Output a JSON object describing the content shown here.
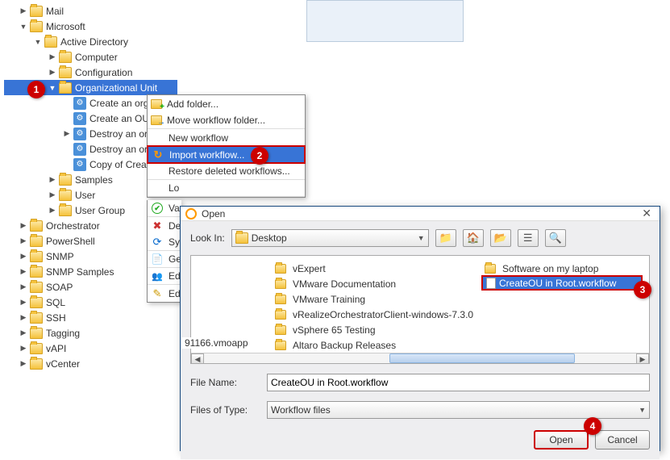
{
  "tree": {
    "mail": "Mail",
    "microsoft": "Microsoft",
    "ad": "Active Directory",
    "computer": "Computer",
    "configuration": "Configuration",
    "ou": "Organizational Unit",
    "create_org": "Create an org",
    "create_ou": "Create an OU",
    "destroy_or": "Destroy an or",
    "destroy_or2": "Destroy an or",
    "copy_of_crea": "Copy of Crea",
    "samples": "Samples",
    "user": "User",
    "user_group": "User Group",
    "orchestrator": "Orchestrator",
    "powershell": "PowerShell",
    "snmp": "SNMP",
    "snmp_samples": "SNMP Samples",
    "soap": "SOAP",
    "sql": "SQL",
    "ssh": "SSH",
    "tagging": "Tagging",
    "vapi": "vAPI",
    "vcenter": "vCenter"
  },
  "ctx": {
    "add_folder": "Add folder...",
    "move_folder": "Move workflow folder...",
    "new_wf": "New workflow",
    "import_wf": "Import workflow...",
    "restore": "Restore deleted workflows...",
    "lo": "Lo",
    "va": "Va",
    "de": "De",
    "sy": "Sy",
    "ge": "Ge",
    "ed": "Ed",
    "ed2": "Ed"
  },
  "dialog": {
    "title": "Open",
    "look_in_label": "Look In:",
    "look_in_value": "Desktop",
    "files": {
      "col1": [
        "vExpert",
        "VMware Documentation",
        "VMware Training",
        "vRealizeOrchestratorClient-windows-7.3.0",
        "vSphere 65 Testing",
        "Altaro Backup Releases"
      ],
      "col2_folder": "Software on my laptop",
      "col2_selected": "CreateOU in Root.workflow"
    },
    "extra_left": "91166.vmoapp",
    "file_name_label": "File Name:",
    "file_name_value": "CreateOU in Root.workflow",
    "files_type_label": "Files of Type:",
    "files_type_value": "Workflow files",
    "open_btn": "Open",
    "cancel_btn": "Cancel"
  },
  "callouts": {
    "c1": "1",
    "c2": "2",
    "c3": "3",
    "c4": "4"
  }
}
